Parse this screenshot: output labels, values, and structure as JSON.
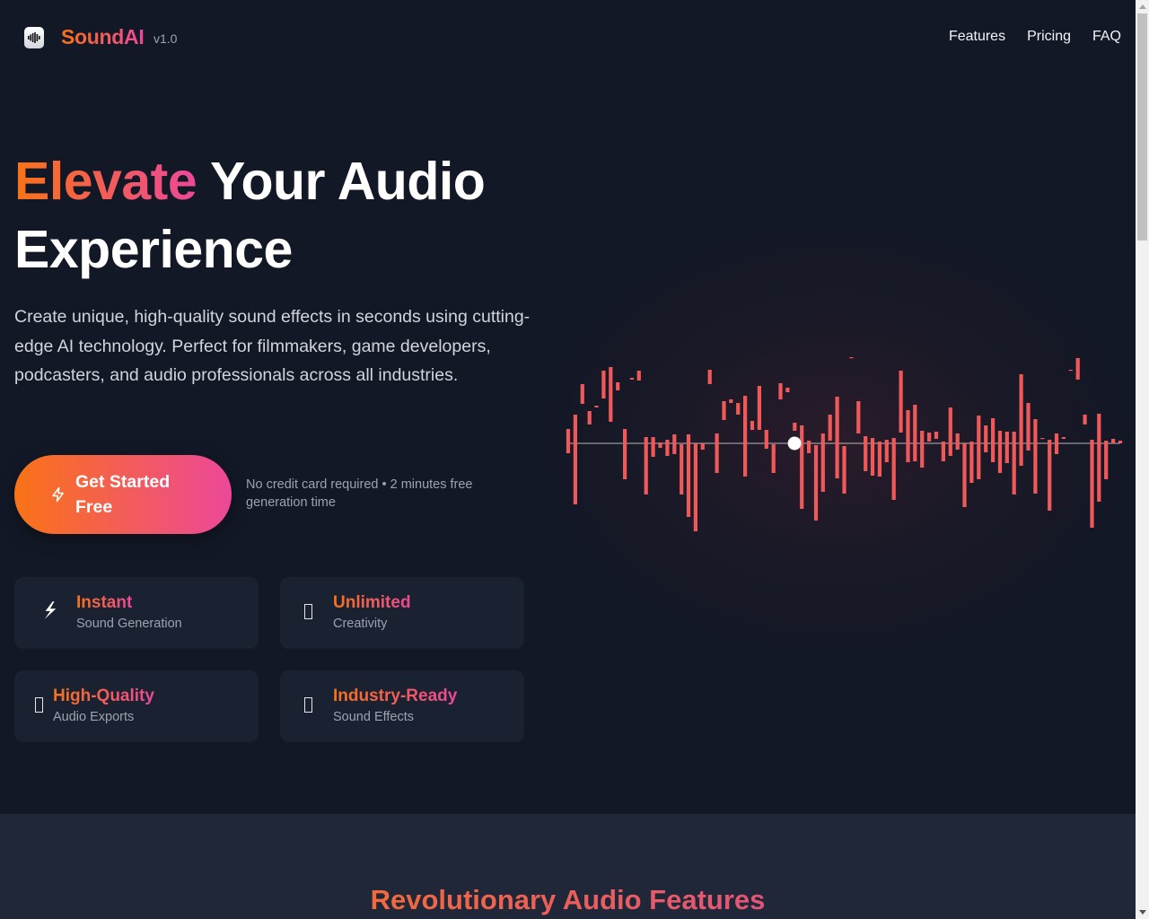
{
  "header": {
    "brand": "SoundAI",
    "version": "v1.0",
    "logo_icon": "waveform-icon",
    "nav": [
      {
        "label": "Features"
      },
      {
        "label": "Pricing"
      },
      {
        "label": "FAQ"
      }
    ]
  },
  "hero": {
    "title_accent": "Elevate",
    "title_rest": " Your Audio Experience",
    "subtitle": "Create unique, high-quality sound effects in seconds using cutting-edge AI technology. Perfect for filmmakers, game developers, podcasters, and audio professionals across all industries.",
    "cta_label": "Get Started Free",
    "cta_icon": "lightning-icon",
    "cta_note": "No credit card required • 2 minutes free generation time"
  },
  "highlights": [
    {
      "icon": "lightning-icon",
      "glyph": "⚡",
      "title": "Instant",
      "subtitle": "Sound Generation"
    },
    {
      "icon": "missing-glyph-icon",
      "glyph": "",
      "title": "Unlimited",
      "subtitle": "Creativity"
    },
    {
      "icon": "missing-glyph-icon",
      "glyph": "",
      "title": "High-Quality",
      "subtitle": "Audio Exports"
    },
    {
      "icon": "missing-glyph-icon",
      "glyph": "",
      "title": "Industry-Ready",
      "subtitle": "Sound Effects"
    }
  ],
  "visualizer": {
    "bar_color": "#f0595a",
    "playhead_position": 0.41,
    "bars": [
      [
        -0.16,
        0.11
      ],
      [
        -0.32,
        0.68
      ],
      [
        -0.66,
        -0.44
      ],
      [
        -0.36,
        -0.21
      ],
      [
        -0.42,
        -0.4
      ],
      [
        -0.81,
        -0.5
      ],
      [
        -0.85,
        -0.24
      ],
      [
        -0.68,
        -0.59
      ],
      [
        -0.16,
        0.4
      ],
      [
        -0.73,
        -0.71
      ],
      [
        -0.81,
        -0.7
      ],
      [
        -0.07,
        0.57
      ],
      [
        -0.07,
        0.15
      ],
      [
        -0.01,
        0.05
      ],
      [
        -0.04,
        0.14
      ],
      [
        -0.1,
        0.12
      ],
      [
        0.01,
        0.57
      ],
      [
        -0.1,
        0.82
      ],
      [
        0.0,
        0.98
      ],
      [
        0.0,
        0.07
      ],
      [
        -0.82,
        -0.66
      ],
      [
        -0.11,
        0.33
      ],
      [
        -0.47,
        -0.26
      ],
      [
        -0.49,
        -0.45
      ],
      [
        -0.45,
        -0.32
      ],
      [
        -0.53,
        0.37
      ],
      [
        -0.25,
        -0.15
      ],
      [
        -0.64,
        -0.15
      ],
      [
        -0.15,
        0.06
      ],
      [
        0.01,
        0.33
      ],
      [
        -0.67,
        -0.49
      ],
      [
        -0.62,
        -0.57
      ],
      [
        -0.23,
        -0.14
      ],
      [
        -0.2,
        0.73
      ],
      [
        -0.03,
        0.11
      ],
      [
        0.02,
        0.86
      ],
      [
        -0.11,
        0.54
      ],
      [
        -0.32,
        -0.03
      ],
      [
        -0.52,
        0.39
      ],
      [
        0.03,
        0.56
      ],
      [
        -0.96,
        -0.95
      ],
      [
        -0.47,
        -0.11
      ],
      [
        -0.08,
        0.31
      ],
      [
        -0.06,
        0.36
      ],
      [
        -0.02,
        0.37
      ],
      [
        -0.04,
        0.21
      ],
      [
        -0.06,
        0.63
      ],
      [
        -0.81,
        -0.12
      ],
      [
        -0.37,
        0.21
      ],
      [
        -0.43,
        0.2
      ],
      [
        -0.14,
        0.27
      ],
      [
        -0.12,
        -0.02
      ],
      [
        -0.13,
        -0.05
      ],
      [
        -0.02,
        0.2
      ],
      [
        -0.4,
        0.14
      ],
      [
        -0.11,
        0.07
      ],
      [
        0.0,
        0.71
      ],
      [
        -0.02,
        0.44
      ],
      [
        -0.31,
        0.4
      ],
      [
        -0.2,
        0.1
      ],
      [
        -0.28,
        0.21
      ],
      [
        -0.14,
        0.33
      ],
      [
        -0.13,
        0.22
      ],
      [
        -0.13,
        0.57
      ],
      [
        -0.77,
        0.25
      ],
      [
        -0.45,
        0.08
      ],
      [
        -0.27,
        0.56
      ],
      [
        -0.06,
        -0.05
      ],
      [
        -0.04,
        0.75
      ],
      [
        -0.11,
        0.12
      ],
      [
        -0.07,
        -0.05
      ],
      [
        -0.82,
        -0.81
      ],
      [
        -0.95,
        -0.71
      ],
      [
        -0.32,
        -0.21
      ],
      [
        -0.04,
        0.94
      ],
      [
        -0.33,
        0.65
      ],
      [
        -0.03,
        0.4
      ],
      [
        -0.05,
        0.0
      ],
      [
        -0.03,
        0.0
      ]
    ]
  },
  "features_section": {
    "title": "Revolutionary Audio Features"
  }
}
